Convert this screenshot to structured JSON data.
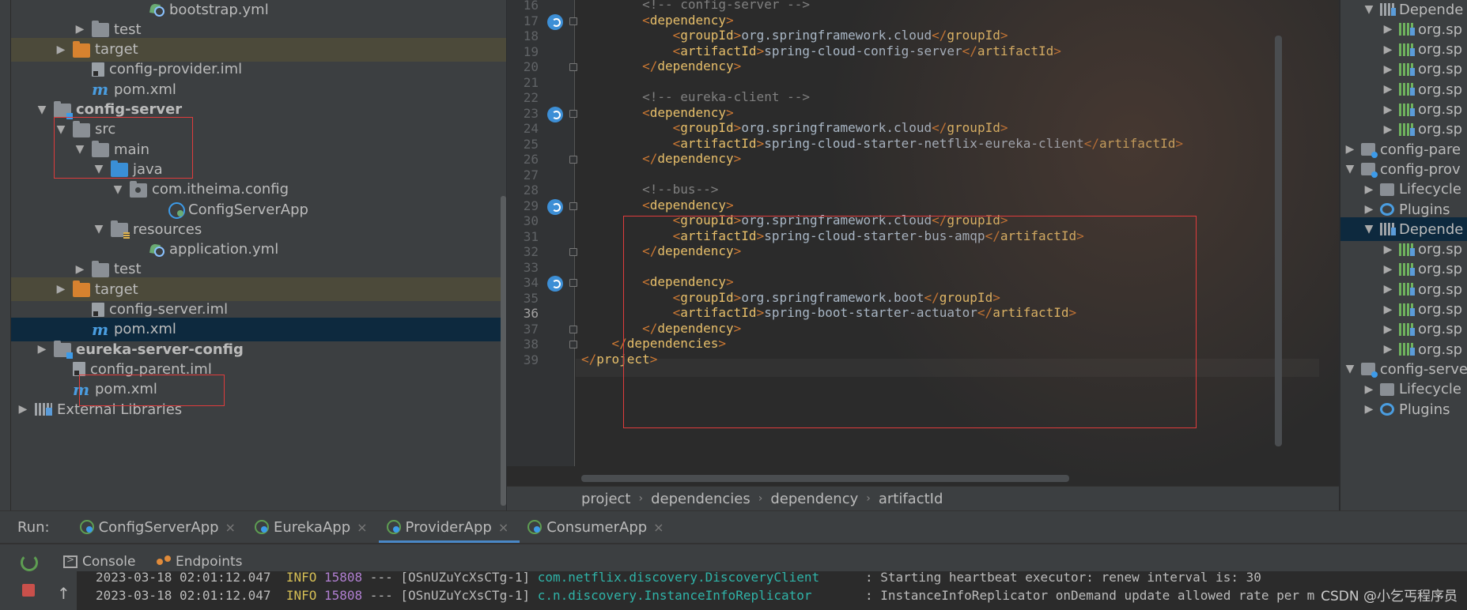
{
  "project_tree": [
    {
      "label": "bootstrap.yml",
      "icon": "yml-file-icon",
      "indent": 6,
      "arrow": ""
    },
    {
      "label": "test",
      "icon": "folder-icon",
      "indent": 3,
      "arrow": "▶"
    },
    {
      "label": "target",
      "icon": "folder-orange-icon",
      "indent": 2,
      "arrow": "▶",
      "highlight": true
    },
    {
      "label": "config-provider.iml",
      "icon": "iml-file-icon",
      "indent": 3,
      "arrow": ""
    },
    {
      "label": "pom.xml",
      "icon": "maven-file-icon",
      "indent": 3,
      "arrow": ""
    },
    {
      "label": "config-server",
      "icon": "module-folder-icon",
      "indent": 1,
      "arrow": "▼",
      "bold": true
    },
    {
      "label": "src",
      "icon": "folder-icon",
      "indent": 2,
      "arrow": "▼"
    },
    {
      "label": "main",
      "icon": "folder-icon",
      "indent": 3,
      "arrow": "▼"
    },
    {
      "label": "java",
      "icon": "source-folder-icon",
      "indent": 4,
      "arrow": "▼"
    },
    {
      "label": "com.itheima.config",
      "icon": "package-icon",
      "indent": 5,
      "arrow": "▼"
    },
    {
      "label": "ConfigServerApp",
      "icon": "class-icon",
      "indent": 7,
      "arrow": ""
    },
    {
      "label": "resources",
      "icon": "resources-folder-icon",
      "indent": 4,
      "arrow": "▼"
    },
    {
      "label": "application.yml",
      "icon": "yml-file-icon",
      "indent": 6,
      "arrow": ""
    },
    {
      "label": "test",
      "icon": "folder-icon",
      "indent": 3,
      "arrow": "▶"
    },
    {
      "label": "target",
      "icon": "folder-orange-icon",
      "indent": 2,
      "arrow": "▶",
      "highlight": true
    },
    {
      "label": "config-server.iml",
      "icon": "iml-file-icon",
      "indent": 3,
      "arrow": ""
    },
    {
      "label": "pom.xml",
      "icon": "maven-file-icon",
      "indent": 3,
      "arrow": "",
      "selected": true
    },
    {
      "label": "eureka-server-config",
      "icon": "module-folder-icon",
      "indent": 1,
      "arrow": "▶",
      "bold": true
    },
    {
      "label": "config-parent.iml",
      "icon": "iml-file-icon",
      "indent": 2,
      "arrow": ""
    },
    {
      "label": "pom.xml",
      "icon": "maven-file-icon",
      "indent": 2,
      "arrow": ""
    },
    {
      "label": "External Libraries",
      "icon": "library-icon",
      "indent": 0,
      "arrow": "▶"
    }
  ],
  "editor": {
    "lines": [
      {
        "n": "16",
        "text": "        <!-- config-server -->",
        "kind": "comment"
      },
      {
        "n": "17",
        "text": "        <dependency>",
        "kind": "tag",
        "gutter": true
      },
      {
        "n": "18",
        "text": "            <groupId>org.springframework.cloud</groupId>",
        "kind": "elem"
      },
      {
        "n": "19",
        "text": "            <artifactId>spring-cloud-config-server</artifactId>",
        "kind": "elem"
      },
      {
        "n": "20",
        "text": "        </dependency>",
        "kind": "tag"
      },
      {
        "n": "21",
        "text": "",
        "kind": "blank"
      },
      {
        "n": "22",
        "text": "        <!-- eureka-client -->",
        "kind": "comment"
      },
      {
        "n": "23",
        "text": "        <dependency>",
        "kind": "tag",
        "gutter": true
      },
      {
        "n": "24",
        "text": "            <groupId>org.springframework.cloud</groupId>",
        "kind": "elem"
      },
      {
        "n": "25",
        "text": "            <artifactId>spring-cloud-starter-netflix-eureka-client</artifactId>",
        "kind": "elem"
      },
      {
        "n": "26",
        "text": "        </dependency>",
        "kind": "tag"
      },
      {
        "n": "27",
        "text": "",
        "kind": "blank"
      },
      {
        "n": "28",
        "text": "        <!--bus-->",
        "kind": "comment"
      },
      {
        "n": "29",
        "text": "        <dependency>",
        "kind": "tag",
        "gutter": true
      },
      {
        "n": "30",
        "text": "            <groupId>org.springframework.cloud</groupId>",
        "kind": "elem"
      },
      {
        "n": "31",
        "text": "            <artifactId>spring-cloud-starter-bus-amqp</artifactId>",
        "kind": "elem"
      },
      {
        "n": "32",
        "text": "        </dependency>",
        "kind": "tag"
      },
      {
        "n": "33",
        "text": "",
        "kind": "blank"
      },
      {
        "n": "34",
        "text": "        <dependency>",
        "kind": "tag",
        "gutter": true
      },
      {
        "n": "35",
        "text": "            <groupId>org.springframework.boot</groupId>",
        "kind": "elem"
      },
      {
        "n": "36",
        "text": "            <artifactId>spring-boot-starter-actuator</artifactId>",
        "kind": "elem",
        "current": true
      },
      {
        "n": "37",
        "text": "        </dependency>",
        "kind": "tag"
      },
      {
        "n": "38",
        "text": "    </dependencies>",
        "kind": "tag"
      },
      {
        "n": "39",
        "text": "</project>",
        "kind": "tag"
      }
    ],
    "breadcrumbs": [
      "project",
      "dependencies",
      "dependency",
      "artifactId"
    ]
  },
  "maven_panel": [
    {
      "label": "Depende",
      "icon": "dependencies-icon",
      "indent": 1,
      "arrow": "▼"
    },
    {
      "label": "org.sp",
      "icon": "library-icon",
      "indent": 2,
      "arrow": "▶"
    },
    {
      "label": "org.sp",
      "icon": "library-icon",
      "indent": 2,
      "arrow": "▶"
    },
    {
      "label": "org.sp",
      "icon": "library-icon",
      "indent": 2,
      "arrow": "▶"
    },
    {
      "label": "org.sp",
      "icon": "library-icon",
      "indent": 2,
      "arrow": "▶"
    },
    {
      "label": "org.sp",
      "icon": "library-icon",
      "indent": 2,
      "arrow": "▶"
    },
    {
      "label": "org.sp",
      "icon": "library-icon",
      "indent": 2,
      "arrow": "▶"
    },
    {
      "label": "config-pare",
      "icon": "maven-project-icon",
      "indent": 0,
      "arrow": "▶"
    },
    {
      "label": "config-prov",
      "icon": "maven-project-icon",
      "indent": 0,
      "arrow": "▼"
    },
    {
      "label": "Lifecycle",
      "icon": "folder-icon",
      "indent": 1,
      "arrow": "▶"
    },
    {
      "label": "Plugins",
      "icon": "gear-icon",
      "indent": 1,
      "arrow": "▶"
    },
    {
      "label": "Depende",
      "icon": "dependencies-icon",
      "indent": 1,
      "arrow": "▼",
      "selected": true
    },
    {
      "label": "org.sp",
      "icon": "library-icon",
      "indent": 2,
      "arrow": "▶"
    },
    {
      "label": "org.sp",
      "icon": "library-icon",
      "indent": 2,
      "arrow": "▶"
    },
    {
      "label": "org.sp",
      "icon": "library-icon",
      "indent": 2,
      "arrow": "▶"
    },
    {
      "label": "org.sp",
      "icon": "library-icon",
      "indent": 2,
      "arrow": "▶"
    },
    {
      "label": "org.sp",
      "icon": "library-icon",
      "indent": 2,
      "arrow": "▶"
    },
    {
      "label": "org.sp",
      "icon": "library-icon",
      "indent": 2,
      "arrow": "▶"
    },
    {
      "label": "config-serve",
      "icon": "maven-project-icon",
      "indent": 0,
      "arrow": "▼"
    },
    {
      "label": "Lifecycle",
      "icon": "folder-icon",
      "indent": 1,
      "arrow": "▶"
    },
    {
      "label": "Plugins",
      "icon": "gear-icon",
      "indent": 1,
      "arrow": "▶"
    }
  ],
  "run_panel": {
    "label": "Run:",
    "tabs": [
      {
        "label": "ConfigServerApp",
        "active": false
      },
      {
        "label": "EurekaApp",
        "active": false
      },
      {
        "label": "ProviderApp",
        "active": true
      },
      {
        "label": "ConsumerApp",
        "active": false
      }
    ],
    "sub_tabs": {
      "console": "Console",
      "endpoints": "Endpoints"
    },
    "log": [
      {
        "ts": "2023-03-18 02:01:12.047",
        "lvl": "INFO",
        "pid": "15808",
        "sep": " --- [OSnUZuYcXsCTg-1] ",
        "cls": "com.netflix.discovery.DiscoveryClient     ",
        "msg": " : Starting heartbeat executor: renew interval is: 30"
      },
      {
        "ts": "2023-03-18 02:01:12.047",
        "lvl": "INFO",
        "pid": "15808",
        "sep": " --- [OSnUZuYcXsCTg-1] ",
        "cls": "c.n.discovery.InstanceInfoReplicator      ",
        "msg": " : InstanceInfoReplicator onDemand update allowed rate per m"
      }
    ]
  },
  "watermark": "CSDN @小乞丐程序员"
}
